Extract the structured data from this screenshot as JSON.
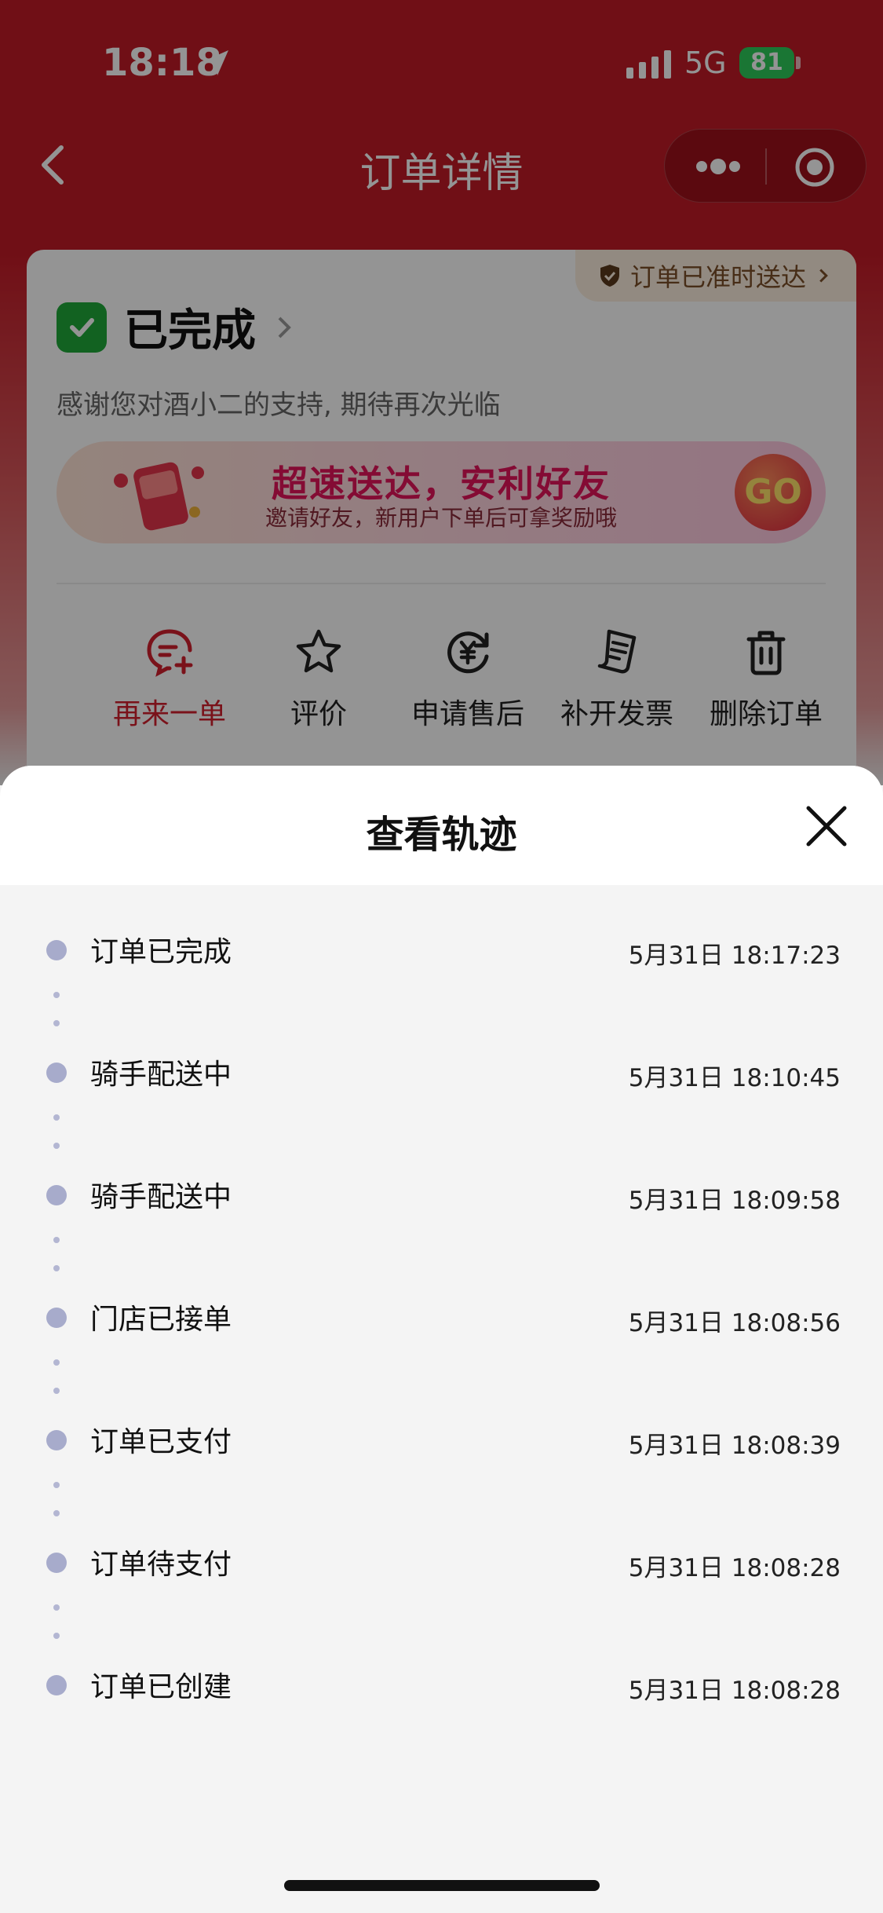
{
  "status_bar": {
    "time": "18:18",
    "network": "5G",
    "battery": "81"
  },
  "nav": {
    "title": "订单详情"
  },
  "order": {
    "ontime_badge": "订单已准时送达",
    "status": "已完成",
    "thanks": "感谢您对酒小二的支持, 期待再次光临",
    "banner": {
      "title": "超速送达，安利好友",
      "subtitle": "邀请好友，新用户下单后可拿奖励哦",
      "go": "GO"
    },
    "actions": [
      {
        "label": "再来一单",
        "icon": "reorder-icon"
      },
      {
        "label": "评价",
        "icon": "star-icon"
      },
      {
        "label": "申请售后",
        "icon": "after-sales-icon"
      },
      {
        "label": "补开发票",
        "icon": "invoice-icon"
      },
      {
        "label": "删除订单",
        "icon": "trash-icon"
      }
    ]
  },
  "sheet": {
    "title": "查看轨迹",
    "events": [
      {
        "label": "订单已完成",
        "time": "5月31日  18:17:23"
      },
      {
        "label": "骑手配送中",
        "time": "5月31日  18:10:45"
      },
      {
        "label": "骑手配送中",
        "time": "5月31日  18:09:58"
      },
      {
        "label": "门店已接单",
        "time": "5月31日  18:08:56"
      },
      {
        "label": "订单已支付",
        "time": "5月31日  18:08:39"
      },
      {
        "label": "订单待支付",
        "time": "5月31日  18:08:28"
      },
      {
        "label": "订单已创建",
        "time": "5月31日  18:08:28"
      }
    ]
  },
  "colors": {
    "brand_red": "#c21a26",
    "success_green": "#1faa3a",
    "timeline_dot": "#a7abcb"
  }
}
